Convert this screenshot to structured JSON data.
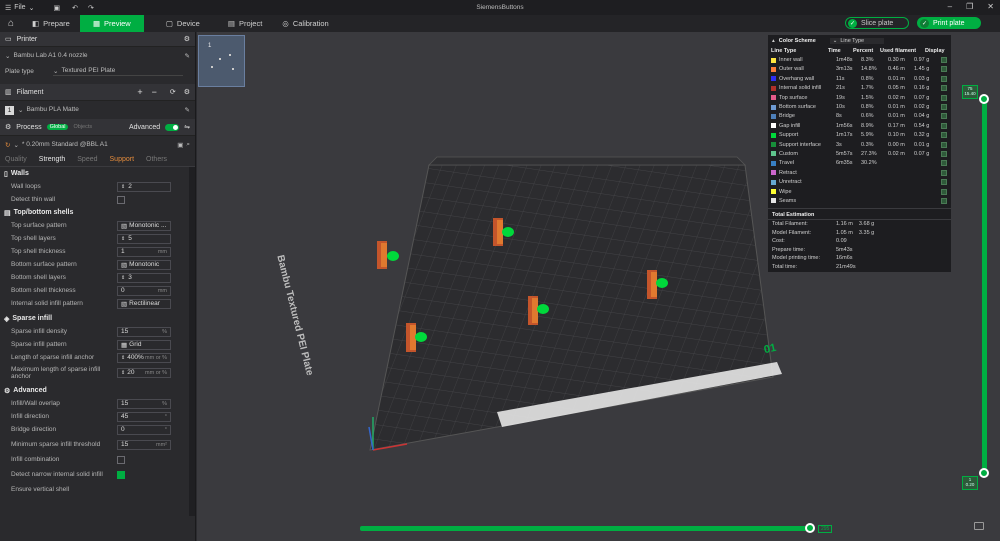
{
  "titlebar": {
    "file_label": "File",
    "title": "SiemensButtons"
  },
  "tabs": [
    {
      "label": "Prepare"
    },
    {
      "label": "Preview"
    },
    {
      "label": "Device"
    },
    {
      "label": "Project"
    },
    {
      "label": "Calibration"
    }
  ],
  "actions": {
    "slice": "Slice plate",
    "print": "Print plate"
  },
  "printer": {
    "heading": "Printer",
    "name": "Bambu Lab A1 0.4 nozzle",
    "plate_label": "Plate type",
    "plate_value": "Textured PEI Plate"
  },
  "filament": {
    "heading": "Filament",
    "slot": "1",
    "name": "Bambu PLA Matte"
  },
  "process": {
    "heading": "Process",
    "global": "Global",
    "objects": "Objects",
    "advanced": "Advanced",
    "preset": "* 0.20mm Standard @BBL A1",
    "subtabs": [
      "Quality",
      "Strength",
      "Speed",
      "Support",
      "Others"
    ]
  },
  "walls": {
    "heading": "Walls",
    "wall_loops_label": "Wall loops",
    "wall_loops": "2",
    "detect_thin_label": "Detect thin wall"
  },
  "topbottom": {
    "heading": "Top/bottom shells",
    "top_pattern_label": "Top surface pattern",
    "top_pattern": "Monotonic ...",
    "top_layers_label": "Top shell layers",
    "top_layers": "5",
    "top_thick_label": "Top shell thickness",
    "top_thick": "1",
    "unit_mm": "mm",
    "bottom_pattern_label": "Bottom surface pattern",
    "bottom_pattern": "Monotonic",
    "bottom_layers_label": "Bottom shell layers",
    "bottom_layers": "3",
    "bottom_thick_label": "Bottom shell thickness",
    "bottom_thick": "0",
    "internal_pattern_label": "Internal solid infill pattern",
    "internal_pattern": "Rectilinear"
  },
  "sparse": {
    "heading": "Sparse infill",
    "density_label": "Sparse infill density",
    "density": "15",
    "unit_pct": "%",
    "pattern_label": "Sparse infill pattern",
    "pattern": "Grid",
    "anchor_label": "Length of sparse infill anchor",
    "anchor": "400%",
    "anchor_unit": "mm or %",
    "max_anchor_label": "Maximum length of sparse infill anchor",
    "max_anchor": "20"
  },
  "advanced": {
    "heading": "Advanced",
    "overlap_label": "Infill/Wall overlap",
    "overlap": "15",
    "direction_label": "Infill direction",
    "direction": "45",
    "unit_deg": "°",
    "bridge_dir_label": "Bridge direction",
    "bridge_dir": "0",
    "min_sparse_label": "Minimum sparse infill threshold",
    "min_sparse": "15",
    "unit_mm2": "mm²",
    "combination_label": "Infill combination",
    "narrow_label": "Detect narrow internal solid infill",
    "ensure_label": "Ensure vertical shell"
  },
  "plate": {
    "thumb_number": "1",
    "label": "Bambu Textured PEI Plate",
    "plate_number": "01"
  },
  "legend": {
    "color_scheme": "Color Scheme",
    "scheme_value": "Line Type",
    "headers": [
      "Line Type",
      "Time",
      "Percent",
      "Used filament",
      "Display"
    ],
    "rows": [
      {
        "name": "Inner wall",
        "time": "1m48s",
        "pct": "8.3%",
        "m": "0.30 m",
        "g": "0.97 g",
        "color": "#ffe640"
      },
      {
        "name": "Outer wall",
        "time": "3m13s",
        "pct": "14.8%",
        "m": "0.46 m",
        "g": "1.45 g",
        "color": "#ff7d38"
      },
      {
        "name": "Overhang wall",
        "time": "11s",
        "pct": "0.8%",
        "m": "0.01 m",
        "g": "0.03 g",
        "color": "#2e2ef2"
      },
      {
        "name": "Internal solid infill",
        "time": "21s",
        "pct": "1.7%",
        "m": "0.05 m",
        "g": "0.16 g",
        "color": "#b03029"
      },
      {
        "name": "Top surface",
        "time": "19s",
        "pct": "1.5%",
        "m": "0.02 m",
        "g": "0.07 g",
        "color": "#e65c8a"
      },
      {
        "name": "Bottom surface",
        "time": "10s",
        "pct": "0.8%",
        "m": "0.01 m",
        "g": "0.02 g",
        "color": "#6e9ad2"
      },
      {
        "name": "Bridge",
        "time": "8s",
        "pct": "0.6%",
        "m": "0.01 m",
        "g": "0.04 g",
        "color": "#4d80ba"
      },
      {
        "name": "Gap infill",
        "time": "1m56s",
        "pct": "8.9%",
        "m": "0.17 m",
        "g": "0.54 g",
        "color": "#ffffff"
      },
      {
        "name": "Support",
        "time": "1m17s",
        "pct": "5.9%",
        "m": "0.10 m",
        "g": "0.32 g",
        "color": "#00d93b"
      },
      {
        "name": "Support interface",
        "time": "3s",
        "pct": "0.3%",
        "m": "0.00 m",
        "g": "0.01 g",
        "color": "#178f3a"
      },
      {
        "name": "Custom",
        "time": "5m57s",
        "pct": "27.3%",
        "m": "0.02 m",
        "g": "0.07 g",
        "color": "#5ec48c"
      },
      {
        "name": "Travel",
        "time": "6m35s",
        "pct": "30.2%",
        "m": "",
        "g": "",
        "color": "#3880c4"
      },
      {
        "name": "Retract",
        "time": "",
        "pct": "",
        "m": "",
        "g": "",
        "color": "#cc66cc"
      },
      {
        "name": "Unretract",
        "time": "",
        "pct": "",
        "m": "",
        "g": "",
        "color": "#66a8d0"
      },
      {
        "name": "Wipe",
        "time": "",
        "pct": "",
        "m": "",
        "g": "",
        "color": "#ffff33"
      },
      {
        "name": "Seams",
        "time": "",
        "pct": "",
        "m": "",
        "g": "",
        "color": "#e6e6e6"
      }
    ],
    "total_heading": "Total Estimation",
    "totals": [
      {
        "k": "Total Filament:",
        "v": "1.16 m    3.68 g"
      },
      {
        "k": "Model Filament:",
        "v": "1.05 m    3.35 g"
      },
      {
        "k": "Cost:",
        "v": "0.09"
      },
      {
        "k": "Prepare time:",
        "v": "5m43s"
      },
      {
        "k": "Model printing time:",
        "v": "16m6s"
      },
      {
        "k": "Total time:",
        "v": "21m49s"
      }
    ]
  },
  "layer_slider": {
    "top": "75\n15.40",
    "bottom": "1\n0.20"
  },
  "move_slider": {
    "value": "295"
  },
  "colors": {
    "accent": "#00ae42"
  }
}
